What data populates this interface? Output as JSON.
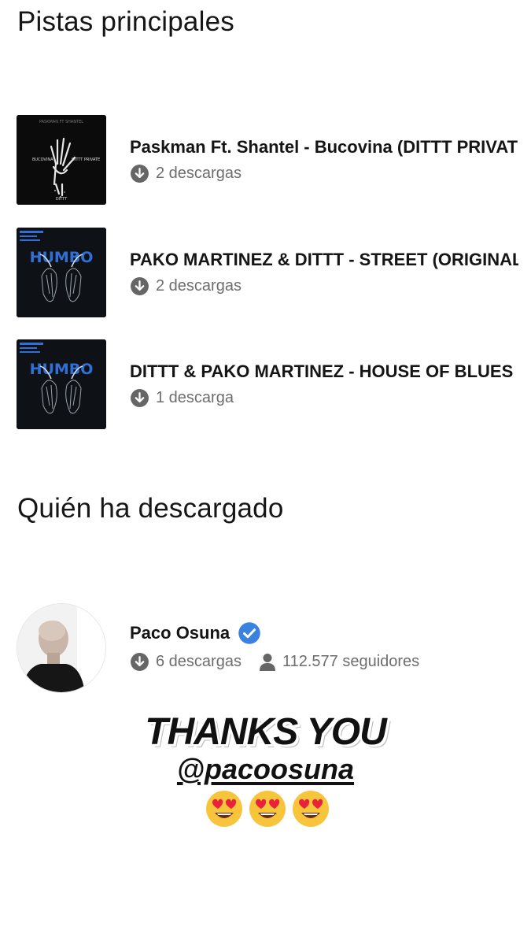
{
  "sections": {
    "top_tracks_title": "Pistas principales",
    "downloaders_title": "Quién ha descargado"
  },
  "tracks": [
    {
      "title": "Paskman Ft. Shantel - Bucovina (DITTT PRIVATE)",
      "downloads": "2 descargas",
      "cover_text": [
        "BUCOVINA",
        "DITTT PRIVATE",
        "DITTT"
      ]
    },
    {
      "title": "PAKO MARTINEZ & DITTT - STREET (ORIGINAL MIX)",
      "downloads": "2 descargas",
      "cover_text": [
        "HUMBO"
      ]
    },
    {
      "title": "DITTT & PAKO MARTINEZ - HOUSE OF BLUES",
      "downloads": "1 descarga",
      "cover_text": [
        "HUMBO"
      ]
    }
  ],
  "downloader": {
    "name": "Paco Osuna",
    "downloads": "6 descargas",
    "followers": "112.577 seguidores",
    "verified": true
  },
  "overlay": {
    "thanks": "THANKS YOU",
    "handle": "@pacoosuna",
    "emoji_icon": "heart-eyes-emoji",
    "emoji_count": 3
  },
  "colors": {
    "text_primary": "#151515",
    "text_secondary": "#6d6d6d",
    "verified_blue": "#3b82e0",
    "humbo_blue": "#2f6fd6"
  }
}
